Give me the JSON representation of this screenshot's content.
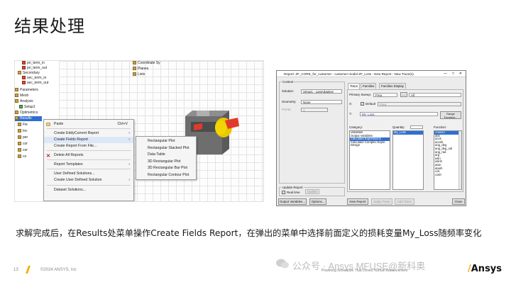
{
  "slide": {
    "title": "结果处理",
    "caption": "求解完成后，在Results处菜单操作Create Fields Report，在弹出的菜单中选择前面定义的损耗变量My_Loss随频率变化",
    "footer": {
      "page": "13",
      "copyright": "©2024 ANSYS, Inc",
      "tagline": "Powering Innovation That Drives Human Advancement",
      "watermark": "公众号 · Ansys MFUSE@新科奥",
      "logo": "Ansys"
    }
  },
  "project_tree": {
    "top_items": [
      "Coordinate Sy",
      "Planes",
      "Lists"
    ],
    "items": [
      {
        "label": "pri_term_in",
        "icon": "terminal-icon"
      },
      {
        "label": "pri_term_out",
        "icon": "terminal-icon"
      },
      {
        "label": "Secondary",
        "icon": "folder-icon"
      },
      {
        "label": "sec_term_in",
        "icon": "terminal-icon"
      },
      {
        "label": "sec_term_out",
        "icon": "terminal-icon"
      },
      {
        "label": "Parameters",
        "icon": "folder-icon"
      },
      {
        "label": "Mesh",
        "icon": "folder-icon"
      },
      {
        "label": "Analysis",
        "icon": "folder-icon"
      },
      {
        "label": "Setup1",
        "icon": "setup-icon"
      },
      {
        "label": "Optimetrics",
        "icon": "folder-icon"
      },
      {
        "label": "Results",
        "icon": "results-icon",
        "selected": true
      },
      {
        "label": "Fie",
        "icon": "folder-icon"
      },
      {
        "label": "Inc",
        "icon": "folder-icon"
      },
      {
        "label": "per",
        "icon": "folder-icon"
      },
      {
        "label": "cor",
        "icon": "folder-icon"
      },
      {
        "label": "cor",
        "icon": "folder-icon"
      },
      {
        "label": "co",
        "icon": "folder-icon"
      }
    ]
  },
  "context_menu": {
    "items": [
      {
        "label": "Paste",
        "shortcut": "Ctrl+V"
      },
      {
        "label": "Create EddyCurrent Report",
        "submenu": true
      },
      {
        "label": "Create Fields Report",
        "submenu": true,
        "highlighted": true
      },
      {
        "label": "Create Report From File..."
      },
      {
        "label": "Delete All Reports"
      },
      {
        "label": "Report Templates",
        "submenu": true
      },
      {
        "label": "User Defined Solutions..."
      },
      {
        "label": "Create User Defined Solution",
        "submenu": true
      },
      {
        "label": "Dataset Solutions..."
      }
    ]
  },
  "sub_menu": {
    "items": [
      "Rectangular Plot",
      "Rectangular Stacked Plot",
      "Data Table",
      "3D Rectangular Plot",
      "3D Rectangular Bar Plot",
      "Rectangular Contour Plot"
    ]
  },
  "dialog": {
    "title": "Report: ZF_CORE_for_customer - customer model ZF_Loss - New Report - New Trace(s)",
    "title_buttons": [
      "—",
      "□",
      "✕"
    ],
    "context": {
      "label": "Context",
      "solution_label": "Solution:",
      "solution_value": "Setup1 : LastAdaptive",
      "geometry_label": "Geometry:",
      "geometry_value": "None",
      "points_label": "Points:",
      "points_value": "1"
    },
    "tabs": [
      "Trace",
      "Families",
      "Families Display"
    ],
    "primary_sweep_label": "Primary Sweep:",
    "primary_sweep_value": "Freq",
    "primary_sweep_all": "All",
    "x_label": "X:",
    "x_default_label": "Default",
    "x_value": "Freq",
    "y_label": "Y:",
    "y_value": "My_Loss",
    "range_function_label": "Range\nFunction...",
    "category_label": "Category:",
    "category_items": [
      "Variables",
      "Output Variables",
      "Calculator Expressions",
      "Calculator Complex Expre",
      "Design"
    ],
    "category_selected": 2,
    "quantity_label": "Quantity:",
    "quantity_items": [
      "My_Loss"
    ],
    "quantity_selected": 0,
    "function_label": "Function:",
    "function_items": [
      "<none>",
      "abs",
      "acos",
      "acosh",
      "ang_deg",
      "ang_deg_val",
      "ang_rad",
      "arg",
      "asin",
      "asinh",
      "atan",
      "atanh",
      "cos",
      "cosh"
    ],
    "function_selected": 0,
    "update_report": {
      "label": "Update Report",
      "realtime_label": "Real time",
      "update_button": "Update"
    },
    "buttons": {
      "output_variables": "Output Variables...",
      "options": "Options...",
      "new_report": "New Report",
      "apply_trace": "Apply Trace",
      "add_trace": "Add Trace",
      "close": "Close"
    }
  }
}
